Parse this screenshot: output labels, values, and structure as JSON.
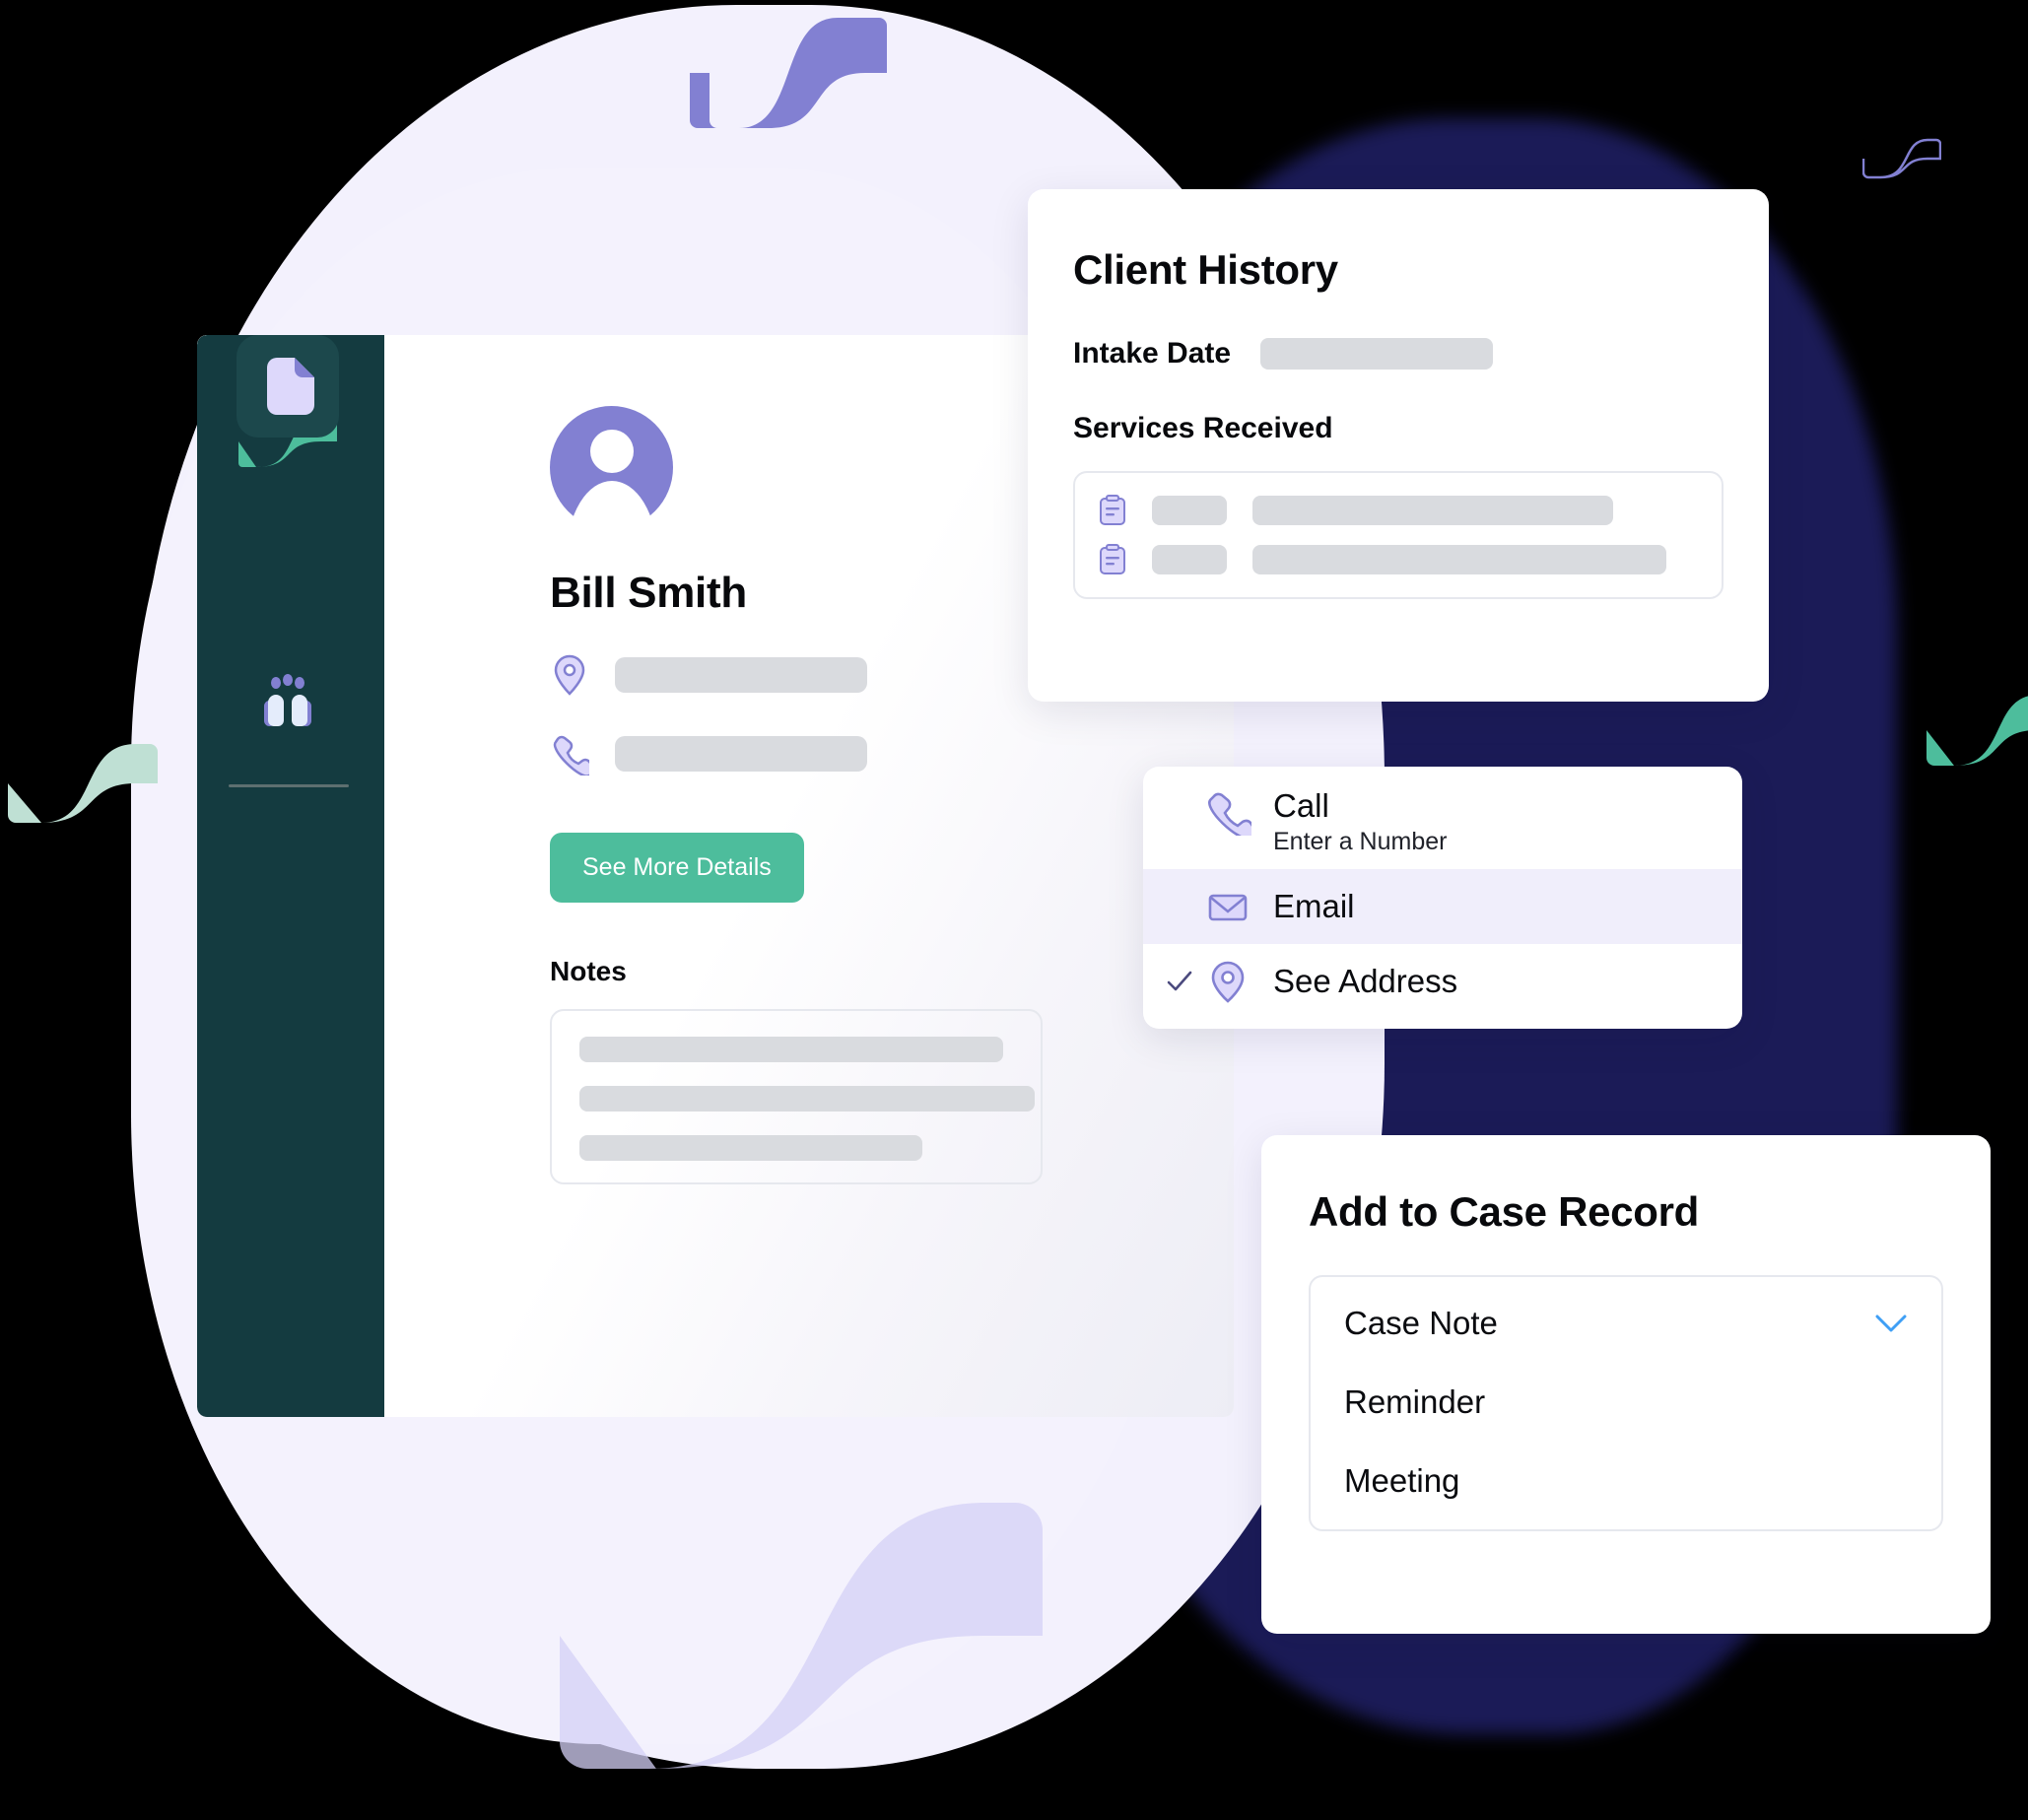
{
  "colors": {
    "brand_green": "#4dbd9c",
    "sidebar_dark": "#143b40",
    "avatar_purple": "#8280d2",
    "icon_lilac": "#c3c0f0",
    "navy_blob": "#1b1b57",
    "lavender_bg": "#f3f1fd",
    "chevron_blue": "#3f9ff5",
    "skeleton_gray": "#d9dbdf"
  },
  "sidebar": {
    "logo_name": "wave-logo",
    "items": [
      {
        "name": "document-icon",
        "active": true
      },
      {
        "name": "people-icon",
        "active": false
      }
    ]
  },
  "profile": {
    "avatar_name": "user-avatar",
    "name": "Bill Smith",
    "contacts": [
      {
        "icon": "map-pin-icon",
        "value": ""
      },
      {
        "icon": "phone-icon",
        "value": ""
      }
    ],
    "see_more_label": "See More Details",
    "notes_heading": "Notes",
    "notes_lines": [
      "",
      "",
      ""
    ]
  },
  "client_history": {
    "title": "Client History",
    "intake_label": "Intake Date",
    "intake_value": "",
    "services_label": "Services Received",
    "services": [
      {
        "icon": "clipboard-note-icon",
        "chip": "",
        "detail": ""
      },
      {
        "icon": "clipboard-note-icon",
        "chip": "",
        "detail": ""
      }
    ]
  },
  "contact_menu": {
    "items": [
      {
        "icon": "phone-icon",
        "label": "Call",
        "sub": "Enter a Number",
        "highlight": false,
        "checked": false
      },
      {
        "icon": "envelope-icon",
        "label": "Email",
        "sub": "",
        "highlight": true,
        "checked": false
      },
      {
        "icon": "map-pin-icon",
        "label": "See Address",
        "sub": "",
        "highlight": false,
        "checked": true
      }
    ]
  },
  "case_record": {
    "title": "Add to Case Record",
    "selected": "Case Note",
    "options": [
      "Reminder",
      "Meeting"
    ]
  }
}
